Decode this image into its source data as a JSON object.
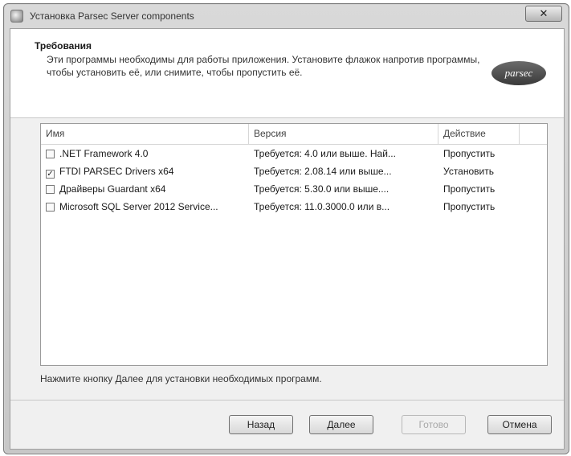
{
  "window": {
    "title": "Установка Parsec Server components"
  },
  "header": {
    "title": "Требования",
    "description": "Эти программы необходимы для работы приложения. Установите флажок напротив программы, чтобы установить её, или снимите, чтобы пропустить её."
  },
  "table": {
    "columns": [
      "Имя",
      "Версия",
      "Действие"
    ],
    "rows": [
      {
        "checked": false,
        "name": ".NET Framework 4.0",
        "version": "Требуется: 4.0 или выше. Най...",
        "action": "Пропустить"
      },
      {
        "checked": true,
        "name": "FTDI PARSEC Drivers x64",
        "version": "Требуется: 2.08.14 или выше...",
        "action": "Установить"
      },
      {
        "checked": false,
        "name": "Драйверы Guardant x64",
        "version": "Требуется: 5.30.0 или выше....",
        "action": "Пропустить"
      },
      {
        "checked": false,
        "name": "Microsoft SQL Server 2012 Service...",
        "version": "Требуется: 11.0.3000.0 или в...",
        "action": "Пропустить"
      }
    ]
  },
  "hint": "Нажмите кнопку Далее для установки необходимых программ.",
  "buttons": {
    "back": "Назад",
    "next": "Далее",
    "finish": "Готово",
    "cancel": "Отмена"
  },
  "logo_text": "parsec",
  "icons": {
    "app": "installer-icon",
    "close": "close-icon",
    "checkbox_checked": "✓"
  },
  "colors": {
    "accent": "#3a3a3a",
    "header_bg": "#ffffff",
    "dialog_bg": "#f0f0f0"
  }
}
